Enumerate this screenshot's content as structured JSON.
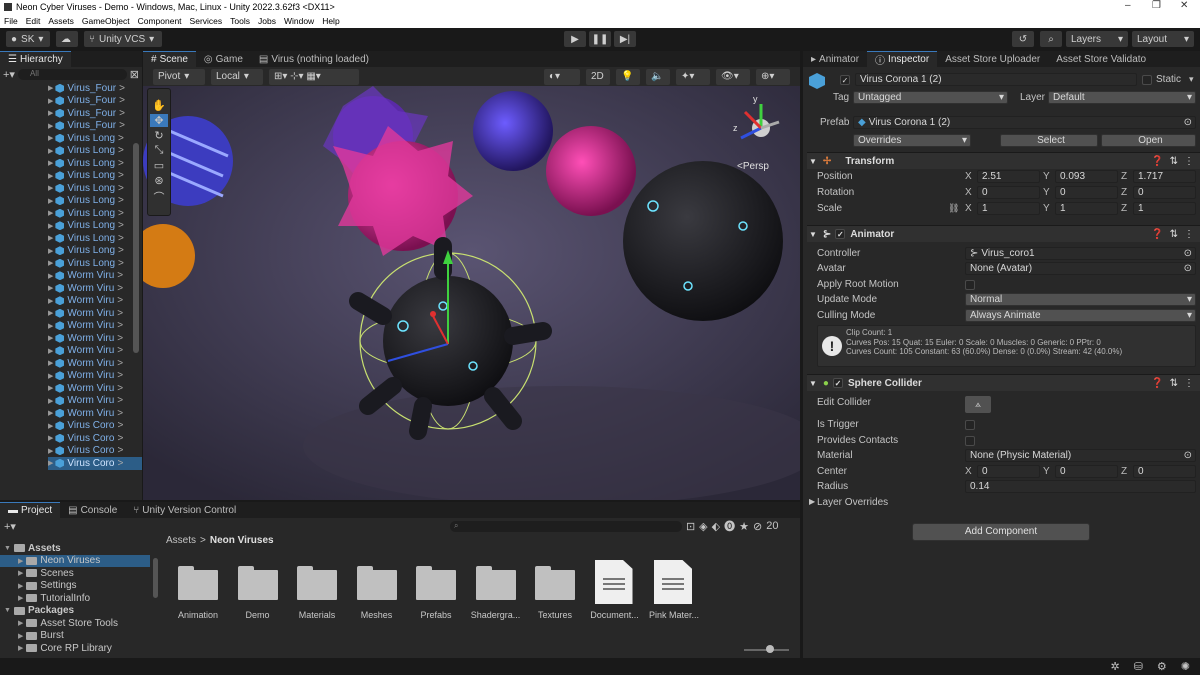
{
  "window": {
    "title": "Neon Cyber Viruses - Demo - Windows, Mac, Linux - Unity 2022.3.62f3 <DX11>"
  },
  "menu": [
    "File",
    "Edit",
    "Assets",
    "GameObject",
    "Component",
    "Services",
    "Tools",
    "Jobs",
    "Window",
    "Help"
  ],
  "toolbar": {
    "account": "SK",
    "vcs": "Unity VCS",
    "layers": "Layers",
    "layout": "Layout"
  },
  "hierarchy": {
    "tab": "Hierarchy",
    "search_placeholder": "All",
    "items": [
      "Virus_Four",
      "Virus_Four",
      "Virus_Four",
      "Virus_Four",
      "Virus Long",
      "Virus Long",
      "Virus Long",
      "Virus Long",
      "Virus Long",
      "Virus Long",
      "Virus Long",
      "Virus Long",
      "Virus Long",
      "Virus Long",
      "Virus Long",
      "Worm Viru",
      "Worm Viru",
      "Worm Viru",
      "Worm Viru",
      "Worm Viru",
      "Worm Viru",
      "Worm Viru",
      "Worm Viru",
      "Worm Viru",
      "Worm Viru",
      "Worm Viru",
      "Worm Viru",
      "Virus Coro",
      "Virus Coro",
      "Virus Coro",
      "Virus Coro"
    ]
  },
  "scene": {
    "tabs": [
      "Scene",
      "Game",
      "Virus (nothing loaded)"
    ],
    "pivot": "Pivot",
    "local": "Local",
    "mode_2d": "2D",
    "persp": "<Persp"
  },
  "inspector": {
    "tabs": [
      "Animator",
      "Inspector",
      "Asset Store Uploader",
      "Asset Store Validato"
    ],
    "object_name": "Virus Corona 1 (2)",
    "static_label": "Static",
    "tag_label": "Tag",
    "tag": "Untagged",
    "layer_label": "Layer",
    "layer": "Default",
    "prefab_label": "Prefab",
    "prefab": "Virus Corona 1 (2)",
    "overrides": "Overrides",
    "select": "Select",
    "open": "Open",
    "transform": {
      "title": "Transform",
      "position_label": "Position",
      "position": [
        "2.51",
        "0.093",
        "1.717"
      ],
      "rotation_label": "Rotation",
      "rotation": [
        "0",
        "0",
        "0"
      ],
      "scale_label": "Scale",
      "scale": [
        "1",
        "1",
        "1"
      ],
      "axes": [
        "X",
        "Y",
        "Z"
      ]
    },
    "animator": {
      "title": "Animator",
      "controller_label": "Controller",
      "controller": "Virus_coro1",
      "avatar_label": "Avatar",
      "avatar": "None (Avatar)",
      "root_motion_label": "Apply Root Motion",
      "update_mode_label": "Update Mode",
      "update_mode": "Normal",
      "culling_mode_label": "Culling Mode",
      "culling_mode": "Always Animate",
      "info": [
        "Clip Count: 1",
        "Curves Pos: 15 Quat: 15 Euler: 0 Scale: 0 Muscles: 0 Generic: 0 PPtr: 0",
        "Curves Count: 105 Constant: 63 (60.0%) Dense: 0 (0.0%) Stream: 42 (40.0%)"
      ]
    },
    "sphere_collider": {
      "title": "Sphere Collider",
      "edit_label": "Edit Collider",
      "trigger_label": "Is Trigger",
      "contacts_label": "Provides Contacts",
      "material_label": "Material",
      "material": "None (Physic Material)",
      "center_label": "Center",
      "center": [
        "0",
        "0",
        "0"
      ],
      "radius_label": "Radius",
      "radius": "0.14",
      "layer_overrides": "Layer Overrides"
    },
    "add_component": "Add Component"
  },
  "project": {
    "tabs": [
      "Project",
      "Console",
      "Unity Version Control"
    ],
    "count": "20",
    "breadcrumb": [
      "Assets",
      "Neon Viruses"
    ],
    "tree": [
      {
        "label": "Assets",
        "level": 0,
        "bold": true
      },
      {
        "label": "Neon Viruses",
        "level": 1,
        "selected": true
      },
      {
        "label": "Scenes",
        "level": 1
      },
      {
        "label": "Settings",
        "level": 1
      },
      {
        "label": "TutorialInfo",
        "level": 1
      },
      {
        "label": "Packages",
        "level": 0,
        "bold": true
      },
      {
        "label": "Asset Store Tools",
        "level": 1
      },
      {
        "label": "Burst",
        "level": 1
      },
      {
        "label": "Core RP Library",
        "level": 1
      }
    ],
    "assets": [
      {
        "label": "Animation",
        "kind": "folder"
      },
      {
        "label": "Demo",
        "kind": "folder"
      },
      {
        "label": "Materials",
        "kind": "folder"
      },
      {
        "label": "Meshes",
        "kind": "folder"
      },
      {
        "label": "Prefabs",
        "kind": "folder"
      },
      {
        "label": "Shadergra...",
        "kind": "folder"
      },
      {
        "label": "Textures",
        "kind": "folder"
      },
      {
        "label": "Document...",
        "kind": "doc"
      },
      {
        "label": "Pink Mater...",
        "kind": "doc"
      }
    ]
  }
}
